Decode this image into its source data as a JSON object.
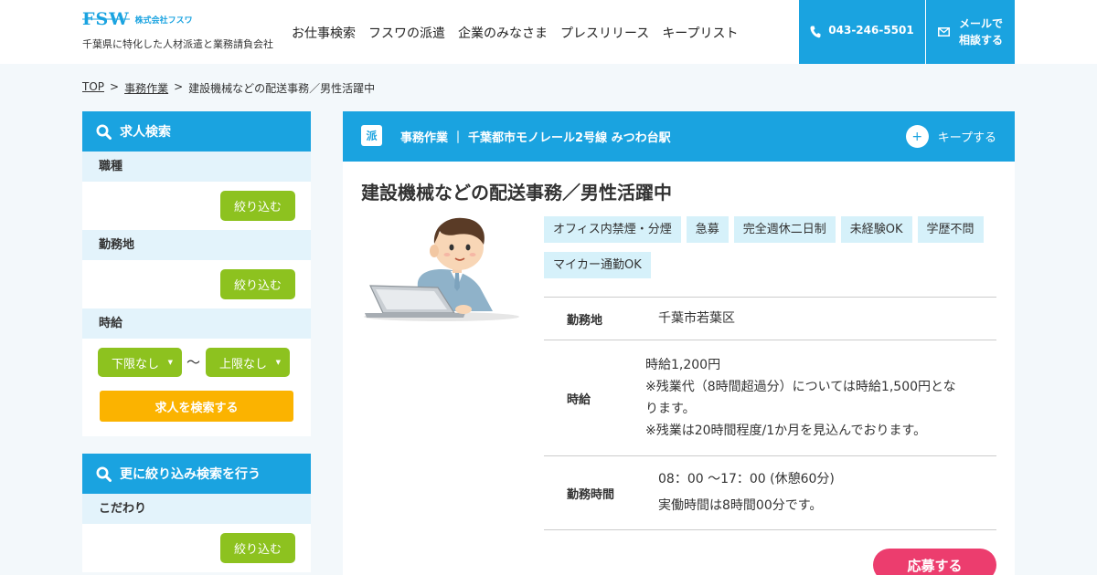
{
  "header": {
    "logo_text": "FSW",
    "logo_company": "株式会社フスワ",
    "tagline": "千葉県に特化した人材派遣と業務請負会社",
    "nav": [
      "お仕事検索",
      "フスワの派遣",
      "企業のみなさま",
      "プレスリリース",
      "キープリスト"
    ],
    "phone": "043-246-5501",
    "mail_line1": "メールで",
    "mail_line2": "相談する"
  },
  "breadcrumb": {
    "top": "TOP",
    "sep1": ">",
    "category": "事務作業",
    "sep2": ">",
    "current": "建設機械などの配送事務／男性活躍中"
  },
  "sidebar": {
    "search_title": "求人検索",
    "job_type_label": "職種",
    "location_label": "勤務地",
    "time_label": "時給",
    "filter_button": "絞り込む",
    "min_select": "下限なし",
    "max_select": "上限なし",
    "tilde": "〜",
    "search_button": "求人を検索する",
    "refine_title": "更に絞り込み検索を行う",
    "kodawari_label": "こだわり"
  },
  "job": {
    "type_badge": "派",
    "category_line": "事務作業 ｜ 千葉都市モノレール2号線 みつわ台駅",
    "keep_label": "キープする",
    "keep_plus": "+",
    "title": "建設機械などの配送事務／男性活躍中",
    "tags": [
      "オフィス内禁煙・分煙",
      "急募",
      "完全週休二日制",
      "未経験OK",
      "学歴不問",
      "マイカー通勤OK"
    ],
    "details": {
      "location_key": "勤務地",
      "location_val": "千葉市若葉区",
      "wage_key": "時給",
      "wage_line1": "時給1,200円",
      "wage_line2": "※残業代（8時間超過分）については時給1,500円とな",
      "wage_line3": "ります。",
      "wage_line4": "※残業は20時間程度/1か月を見込んでおります。",
      "hours_key": "勤務時間",
      "hours_line1": "08：00 〜17：00 (休憩60分)",
      "hours_line2": "実働時間は8時間00分です。"
    },
    "apply_button": "応募する"
  },
  "colors": {
    "primary": "#1aa3e0",
    "green": "#8dc21f",
    "orange": "#fbb300",
    "pink": "#ec3d6e",
    "tag_bg": "#d6f1fa"
  }
}
